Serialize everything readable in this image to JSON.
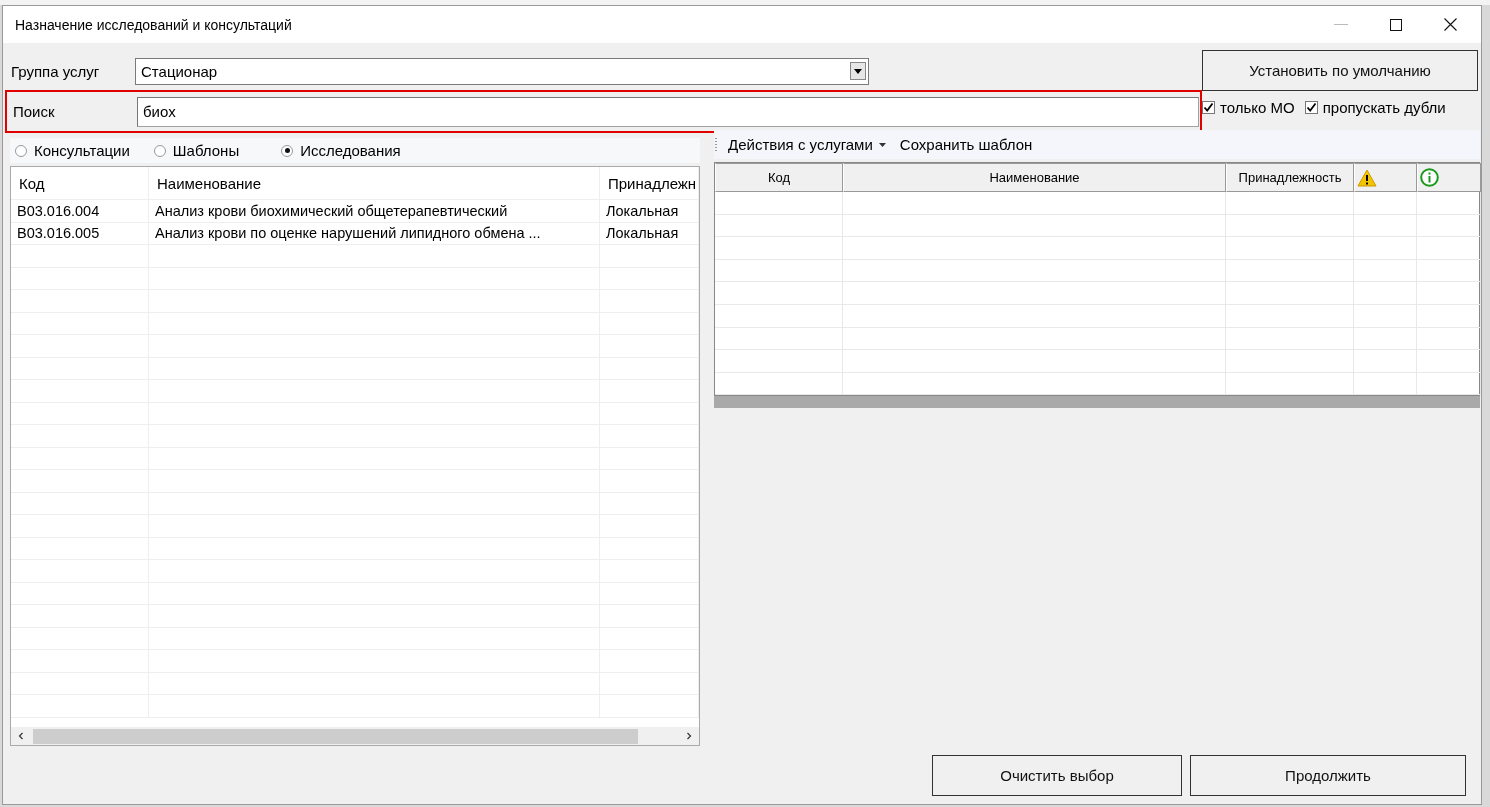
{
  "window": {
    "title": "Назначение исследований и консультаций"
  },
  "service_group": {
    "label": "Группа услуг",
    "value": "Стационар"
  },
  "default_button": "Установить по умолчанию",
  "search": {
    "label": "Поиск",
    "value": "биох"
  },
  "options": [
    {
      "label": "только МО",
      "checked": true
    },
    {
      "label": "пропускать дубли",
      "checked": true
    }
  ],
  "mode_radios": [
    {
      "label": "Консультации",
      "selected": false
    },
    {
      "label": "Шаблоны",
      "selected": false
    },
    {
      "label": "Исследования",
      "selected": true
    }
  ],
  "left_table": {
    "columns": [
      "Код",
      "Наименование",
      "Принадлежн"
    ],
    "rows": [
      [
        "B03.016.004",
        "Анализ крови биохимический общетерапевтический",
        "Локальная"
      ],
      [
        "B03.016.005",
        "Анализ крови по оценке нарушений липидного обмена ...",
        "Локальная"
      ]
    ]
  },
  "right_toolbar": [
    {
      "label": "Действия с услугами",
      "kind": "dropdown"
    },
    {
      "label": "Сохранить шаблон",
      "kind": "button"
    }
  ],
  "right_table": {
    "columns": [
      {
        "kind": "text",
        "label": "Код"
      },
      {
        "kind": "text",
        "label": "Наименование"
      },
      {
        "kind": "text",
        "label": "Принадлежность"
      },
      {
        "kind": "warning"
      },
      {
        "kind": "info"
      }
    ]
  },
  "buttons": [
    "Очистить выбор",
    "Продолжить"
  ]
}
